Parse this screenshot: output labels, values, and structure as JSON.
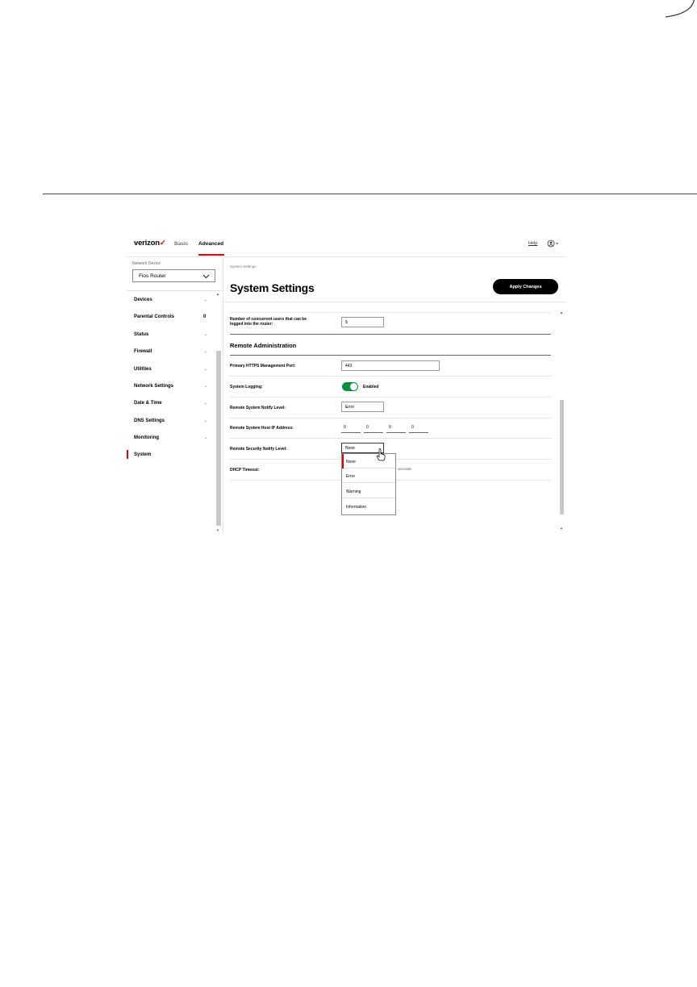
{
  "header": {
    "logo": "verizon",
    "tabs": [
      "Basic",
      "Advanced"
    ],
    "active_tab": "Advanced",
    "help": "Help"
  },
  "sidebar": {
    "network_device_label": "Network Device",
    "network_device_value": "Fios Router",
    "items": [
      {
        "label": "Devices",
        "marker": "⌄"
      },
      {
        "label": "Parental Controls",
        "marker": "0"
      },
      {
        "label": "Status",
        "marker": "⌄"
      },
      {
        "label": "Firewall",
        "marker": "⌄"
      },
      {
        "label": "Utilities",
        "marker": "⌄"
      },
      {
        "label": "Network Settings",
        "marker": "⌄"
      },
      {
        "label": "Date & Time",
        "marker": "⌄"
      },
      {
        "label": "DNS Settings",
        "marker": "⌄"
      },
      {
        "label": "Monitoring",
        "marker": "⌄"
      },
      {
        "label": "System",
        "marker": ""
      }
    ],
    "active_item": "System"
  },
  "main": {
    "breadcrumb": "System Settings",
    "title": "System Settings",
    "apply_button": "Apply Changes",
    "concurrent_users": {
      "label_line1": "Number of concurrent users that can be",
      "label_line2": "logged into the router:",
      "value": "5"
    },
    "remote_admin_title": "Remote Administration",
    "https_port": {
      "label": "Primary HTTPS Management Port:",
      "value": "443"
    },
    "system_logging": {
      "label": "System Logging:",
      "state": "Enabled"
    },
    "remote_notify": {
      "label": "Remote System Notify Level:",
      "value": "Error"
    },
    "remote_host_ip": {
      "label": "Remote System Host IP Address:",
      "octets": [
        "0",
        "0",
        "0",
        "0"
      ]
    },
    "security_notify": {
      "label": "Remote Security Notify Level:",
      "value": "None",
      "options": [
        "None",
        "Error",
        "Warning",
        "Information"
      ]
    },
    "dhcp_timeout": {
      "label": "DHCP Timeout:",
      "unit": "seconds"
    }
  },
  "colors": {
    "accent": "#ee0000",
    "toggle_on": "#0a8f3c",
    "button": "#000000"
  }
}
